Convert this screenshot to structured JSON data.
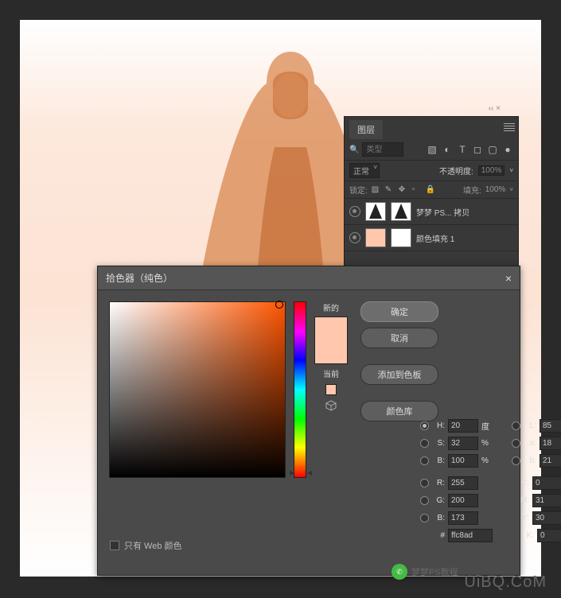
{
  "layers_panel": {
    "title": "图层",
    "search_placeholder": "类型",
    "blend_mode": "正常",
    "opacity_label": "不透明度:",
    "opacity_value": "100%",
    "lock_label": "锁定:",
    "fill_label": "填充:",
    "fill_value": "100%",
    "layers": [
      {
        "name": "梦梦 PS... 拷贝"
      },
      {
        "name": "颜色填充 1"
      }
    ]
  },
  "picker": {
    "title": "拾色器（纯色）",
    "close": "×",
    "new_label": "新的",
    "current_label": "当前",
    "buttons": {
      "ok": "确定",
      "cancel": "取消",
      "add": "添加到色板",
      "lib": "颜色库"
    },
    "web_only": "只有 Web 颜色",
    "fields": {
      "H": {
        "label": "H:",
        "value": "20",
        "unit": "度"
      },
      "S": {
        "label": "S:",
        "value": "32",
        "unit": "%"
      },
      "Bv": {
        "label": "B:",
        "value": "100",
        "unit": "%"
      },
      "L": {
        "label": "L:",
        "value": "85"
      },
      "a": {
        "label": "a:",
        "value": "18"
      },
      "b": {
        "label": "b:",
        "value": "21"
      },
      "R": {
        "label": "R:",
        "value": "255"
      },
      "G": {
        "label": "G:",
        "value": "200"
      },
      "Bb": {
        "label": "B:",
        "value": "173"
      },
      "C": {
        "label": "C:",
        "value": "0",
        "unit": "%"
      },
      "M": {
        "label": "M:",
        "value": "31",
        "unit": "%"
      },
      "Y": {
        "label": "Y:",
        "value": "30",
        "unit": "%"
      },
      "K": {
        "label": "K:",
        "value": "0",
        "unit": "%"
      },
      "hex_label": "#",
      "hex": "ffc8ad"
    },
    "colors": {
      "new_swatch": "#ffc8ad",
      "current_swatch": "#ffc8ad",
      "hue_deg": 20
    }
  },
  "watermark": {
    "brand": "梦梦PS教程",
    "url": "UiBQ.CoM"
  }
}
